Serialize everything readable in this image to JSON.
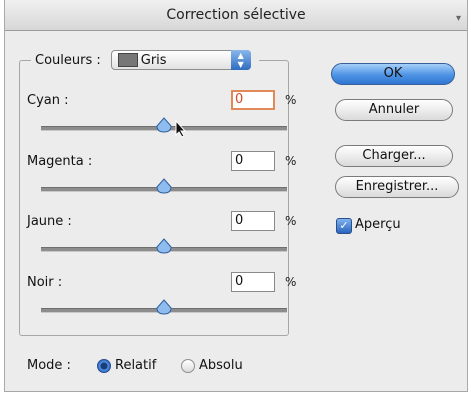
{
  "window": {
    "title": "Correction sélective",
    "corner_mark": "▾"
  },
  "colors": {
    "label": "Couleurs :",
    "selected": "Gris",
    "swatch": "#767676",
    "popup_arrows_icon": "up-down-arrows"
  },
  "sliders": [
    {
      "label": "Cyan :",
      "value": "0",
      "unit": "%",
      "focused": true
    },
    {
      "label": "Magenta :",
      "value": "0",
      "unit": "%",
      "focused": false
    },
    {
      "label": "Jaune :",
      "value": "0",
      "unit": "%",
      "focused": false
    },
    {
      "label": "Noir :",
      "value": "0",
      "unit": "%",
      "focused": false
    }
  ],
  "buttons": {
    "ok": "OK",
    "cancel": "Annuler",
    "load": "Charger...",
    "save": "Enregistrer..."
  },
  "preview": {
    "label": "Aperçu",
    "checked": true
  },
  "mode": {
    "label": "Mode :",
    "options": [
      "Relatif",
      "Absolu"
    ],
    "selected": "Relatif"
  },
  "accent": "#3a7fd8"
}
